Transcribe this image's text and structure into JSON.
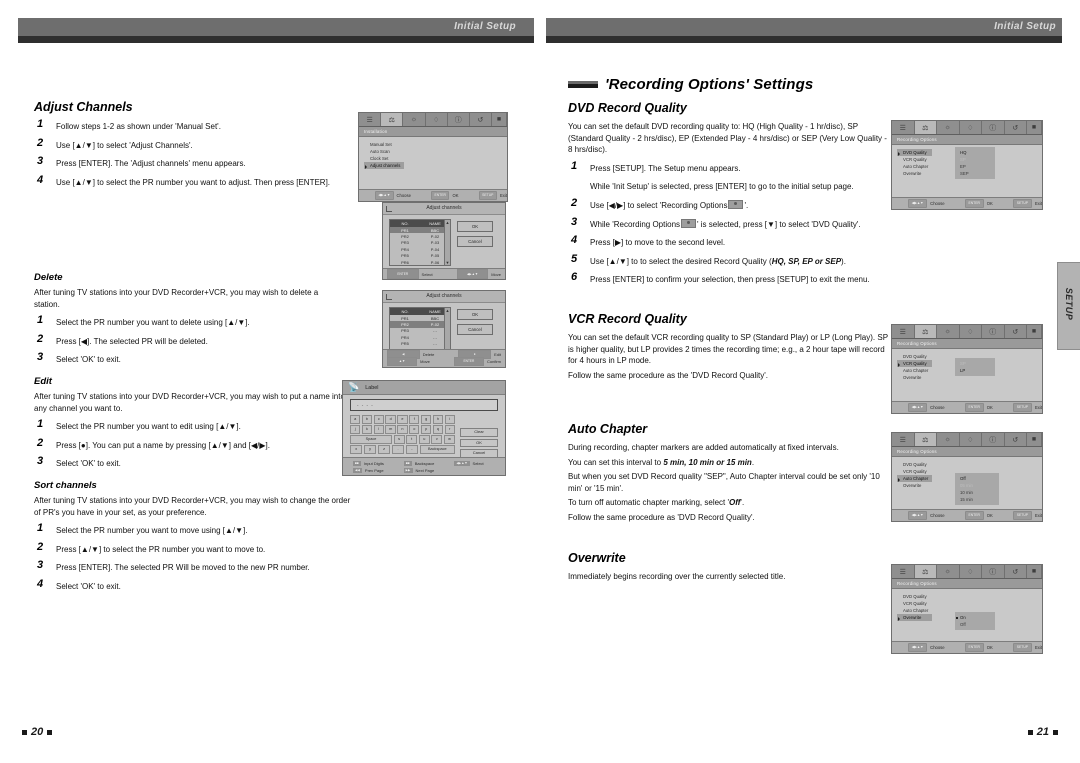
{
  "header": {
    "left_label": "Initial Setup",
    "right_label": "Initial Setup"
  },
  "side_tab": {
    "label": "SETUP"
  },
  "footer": {
    "left_page": "20",
    "right_page": "21"
  },
  "left_page": {
    "sections": [
      {
        "title": "Adjust Channels",
        "steps": [
          "Follow steps 1-2 as shown under 'Manual Set'.",
          "Use [▲/▼] to select 'Adjust Channels'.",
          "Press [ENTER]. The 'Adjust channels' menu appears.",
          "Use [▲/▼] to select the PR number you want to adjust. Then press [ENTER]."
        ]
      },
      {
        "title": "Delete",
        "intro": "After tuning TV stations into your DVD Recorder+VCR, you may wish to delete a station.",
        "steps": [
          "Select the PR number you want to delete using [▲/▼].",
          "Press [◀]. The selected PR will be deleted.",
          "Select 'OK' to exit."
        ]
      },
      {
        "title": "Edit",
        "intro": "After tuning TV stations into your DVD Recorder+VCR, you may wish to put a name into any channel you want to.",
        "steps": [
          "Select the PR number you want to edit using [▲/▼].",
          "Press [●]. You can put a name by pressing [▲/▼] and [◀/▶].",
          "Select 'OK' to exit."
        ]
      },
      {
        "title": "Sort channels",
        "intro": "After tuning TV stations into your DVD Recorder+VCR, you may wish to change the order of PR's you have in your set, as your preference.",
        "steps": [
          "Select the PR number you want to move using [▲/▼].",
          "Press [▲/▼] to select the PR number you want to move to.",
          "Press [ENTER]. The selected PR Will be moved to the new PR number.",
          "Select 'OK' to exit."
        ]
      }
    ]
  },
  "right_page": {
    "title": "'Recording Options' Settings",
    "sections": [
      {
        "title": "DVD Record Quality",
        "intro": "You can set the default DVD recording quality to: HQ (High Quality - 1 hr/disc), SP (Standard Quality - 2 hrs/disc), EP (Extended Play - 4 hrs/disc) or SEP (Very Low Quality - 8 hrs/disc).",
        "steps": [
          "Press [SETUP]. The Setup menu appears.",
          "Use [◀/▶] to select 'Recording Options",
          "While 'Recording Options",
          "Press [▶] to move to the second level.",
          "Use [▲/▼] to to select the desired Record Quality (",
          "Press [ENTER] to confirm your selection, then press [SETUP] to exit the menu."
        ],
        "substep_note": "While 'Init Setup' is selected, press [ENTER] to go to the initial setup page.",
        "step2_tail": "'.",
        "step3_tail": "' is selected, press [▼] to select 'DVD Quality'.",
        "step5_qualities": "HQ, SP, EP or SEP",
        "step5_tail": ")."
      },
      {
        "title": "VCR Record Quality",
        "intro": "You can set the default VCR recording quality to SP (Standard Play) or LP (Long Play). SP is higher quality, but LP provides 2 times the recording time; e.g., a 2 hour tape will record for 4 hours in LP mode.",
        "follow": "Follow the same procedure as the 'DVD Record Quality'."
      },
      {
        "title": "Auto Chapter",
        "line1": "During recording, chapter markers are added automatically at fixed intervals.",
        "line2_pre": "You can set this interval to ",
        "line2_values": "5 min, 10 min or 15 min",
        "line2_post": ".",
        "line3": "But when you set DVD Record quality \"SEP\", Auto Chapter interval could be set only '10 min' or '15 min'.",
        "line4_pre": "To turn off automatic chapter marking, select '",
        "line4_val": "Off",
        "line4_post": "'.",
        "follow": "Follow the same procedure as 'DVD Record Quality'."
      },
      {
        "title": "Overwrite",
        "intro": "Immediately begins recording over the currently selected title."
      }
    ]
  },
  "osd_screens": {
    "installation": {
      "title": "Installation",
      "items": [
        "Manual Set",
        "Auto Scan",
        "Clock Set",
        "Adjust channels"
      ],
      "selected_index": 3,
      "footer": {
        "nav_key": "◀▶▲▼",
        "nav_label": "Choose",
        "enter_key": "ENTER",
        "enter_label": "OK",
        "setup_key": "SETUP",
        "setup_label": "Exit"
      }
    },
    "adjust_channels_1": {
      "title": "Adjust channels",
      "columns": [
        "NO.",
        "NAME"
      ],
      "rows": [
        [
          "PR1",
          "BBC"
        ],
        [
          "PR2",
          "P-02"
        ],
        [
          "PR3",
          "P-03"
        ],
        [
          "PR4",
          "P-04"
        ],
        [
          "PR5",
          "P-05"
        ],
        [
          "PR6",
          "P-06"
        ]
      ],
      "selected_row": 0,
      "buttons": [
        "OK",
        "Cancel"
      ],
      "footer": [
        {
          "key": "ENTER",
          "label": "Select"
        },
        {
          "key": "◀▶▲▼",
          "label": "Move"
        }
      ]
    },
    "adjust_channels_2": {
      "title": "Adjust channels",
      "columns": [
        "NO.",
        "NAME"
      ],
      "rows": [
        [
          "PR1",
          "BBC"
        ],
        [
          "PR2",
          "P-02"
        ],
        [
          "PR3",
          "- -"
        ],
        [
          "PR4",
          "- -"
        ],
        [
          "PR5",
          "- -"
        ],
        [
          "PR6",
          "- -"
        ]
      ],
      "selected_row": 1,
      "buttons": [
        "OK",
        "Cancel"
      ],
      "footer": [
        {
          "key": "◀",
          "label": "Delete"
        },
        {
          "key": "●",
          "label": "Edit"
        },
        {
          "key": "▲▼",
          "label": "Move"
        },
        {
          "key": "ENTER",
          "label": "Confirm"
        }
      ]
    },
    "label": {
      "title": "Label",
      "field_value": "- - - -",
      "keys_row1": [
        "a",
        "b",
        "c",
        "d",
        "e",
        "f",
        "g",
        "h",
        "i"
      ],
      "keys_row2": [
        "j",
        "k",
        "l",
        "m",
        "n",
        "o",
        "p",
        "q",
        "r"
      ],
      "keys_row3": [
        "Space",
        "s",
        "t",
        "u",
        "v",
        "w"
      ],
      "keys_row4": [
        "x",
        "y",
        "z",
        ".",
        "-",
        "Backspace"
      ],
      "side_buttons": [
        "Clear",
        "OK",
        "Cancel"
      ],
      "legend": [
        {
          "icon": "open-circle",
          "label": "A"
        },
        {
          "icon": "filled-circle",
          "label": "a"
        },
        {
          "icon": "open-circle",
          "label": "Symbol"
        }
      ],
      "footer": [
        {
          "key": "■■",
          "label": "Input Digits"
        },
        {
          "key": "■■",
          "label": "Backspace"
        },
        {
          "key": "◀▶▲▼",
          "label": "Select"
        },
        {
          "key": "◀◀",
          "label": "Prev Page"
        },
        {
          "key": "▶▶",
          "label": "Next Page"
        }
      ]
    },
    "recording_dvd": {
      "title": "Recording Options",
      "items": [
        "DVD Quality",
        "VCR Quality",
        "Auto Chapter",
        "Overwrite"
      ],
      "selected_index": 0,
      "sub_items": [
        "HQ",
        "SP",
        "EP",
        "SEP"
      ],
      "sub_selected": 0,
      "footer": {
        "nav_key": "◀▶▲▼",
        "nav_label": "Choose",
        "enter_key": "ENTER",
        "enter_label": "OK",
        "setup_key": "SETUP",
        "setup_label": "Exit"
      }
    },
    "recording_vcr": {
      "title": "Recording Options",
      "items": [
        "DVD Quality",
        "VCR Quality",
        "Auto Chapter",
        "Overwrite"
      ],
      "selected_index": 1,
      "sub_items": [
        "SP",
        "LP"
      ],
      "sub_selected": 0,
      "footer": {
        "nav_key": "◀▶▲▼",
        "nav_label": "Choose",
        "enter_key": "ENTER",
        "enter_label": "OK",
        "setup_key": "SETUP",
        "setup_label": "Exit"
      }
    },
    "recording_chapter": {
      "title": "Recording Options",
      "items": [
        "DVD Quality",
        "VCR Quality",
        "Auto Chapter",
        "Overwrite"
      ],
      "selected_index": 2,
      "sub_items": [
        "Off",
        "05 min",
        "10 min",
        "15 min"
      ],
      "sub_selected": 1,
      "footer": {
        "nav_key": "◀▶▲▼",
        "nav_label": "Choose",
        "enter_key": "ENTER",
        "enter_label": "OK",
        "setup_key": "SETUP",
        "setup_label": "Exit"
      }
    },
    "recording_overwrite": {
      "title": "Recording Options",
      "items": [
        "DVD Quality",
        "VCR Quality",
        "Auto Chapter",
        "Overwrite"
      ],
      "selected_index": 3,
      "sub_items": [
        "On",
        "Off"
      ],
      "sub_selected": 0,
      "footer": {
        "nav_key": "◀▶▲▼",
        "nav_label": "Choose",
        "enter_key": "ENTER",
        "enter_label": "OK",
        "setup_key": "SETUP",
        "setup_label": "Exit"
      }
    },
    "tab_icons": [
      "playback-icon",
      "recording-icon",
      "language-icon",
      "display-icon",
      "info-icon",
      "install-icon",
      "reset-icon"
    ]
  }
}
